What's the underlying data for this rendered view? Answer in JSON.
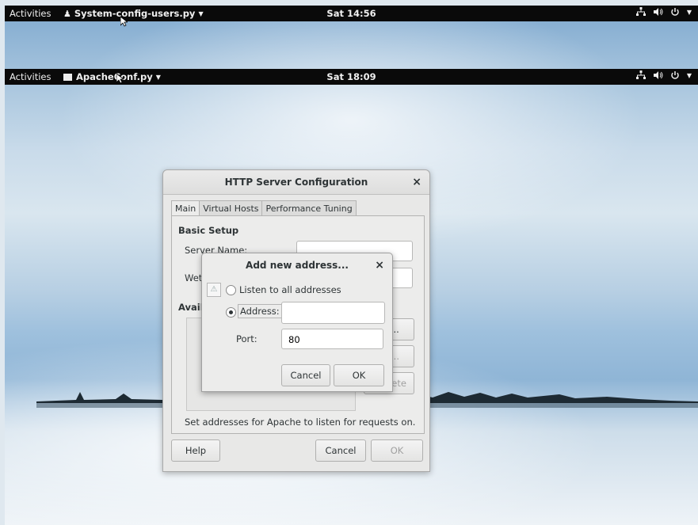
{
  "top_bar_back": {
    "activities": "Activities",
    "app_name": "System-config-users.py",
    "clock": "Sat 14:56"
  },
  "top_bar_front": {
    "activities": "Activities",
    "app_name": "ApacheConf.py",
    "clock": "Sat 18:09"
  },
  "tray": {
    "network_icon": "network-icon",
    "volume_icon": "volume-icon",
    "power_icon": "power-icon"
  },
  "main_dialog": {
    "title": "HTTP Server Configuration",
    "close": "×",
    "tabs": [
      "Main",
      "Virtual Hosts",
      "Performance Tuning"
    ],
    "basic_setup": "Basic Setup",
    "server_name_label": "Server Name:",
    "webmaster_label": "Wet",
    "available_label": "Availa",
    "add_button": "dd...",
    "edit_button": "dit...",
    "delete_button": "elete",
    "hint": "Set addresses for Apache to listen for requests on.",
    "help_button": "Help",
    "cancel_button": "Cancel",
    "ok_button": "OK"
  },
  "add_dialog": {
    "title": "Add new address...",
    "close": "×",
    "listen_all_label": "Listen to all addresses",
    "address_label": "Address:",
    "address_value": "",
    "port_label": "Port:",
    "port_value": "80",
    "cancel_button": "Cancel",
    "ok_button": "OK"
  }
}
